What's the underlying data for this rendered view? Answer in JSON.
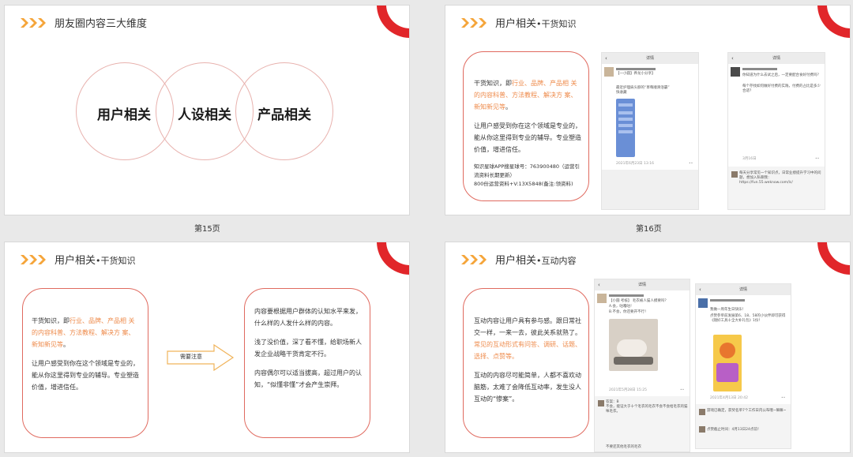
{
  "colors": {
    "accent_orange": "#f5a53a",
    "brand_red": "#e1262a",
    "border_red": "#e06a5f",
    "highlight_orange": "#ee8a4a",
    "circle_pink": "#e8b2ae"
  },
  "pages": {
    "p15": "第15页",
    "p16": "第16页"
  },
  "slide1": {
    "title": "朋友圈内容三大维度",
    "circles": [
      "用户相关",
      "人设相关",
      "产品相关"
    ]
  },
  "slide2": {
    "title_main": "用户相关",
    "title_sub": "•干货知识",
    "text": {
      "p1_a": "干货知识，即",
      "p1_hl": "行业、品牌、产品相 关的内容科普、方法教程、解决方 案、新知新见等",
      "p1_b": "。",
      "p2": "让用户感受到你在这个领域是专业的，能从你这里得到专业的辅导。专业塑造价值，增进信任。",
      "p3": "知识星球APP搜星球号：763900480（运营引流资料长期更新）",
      "p4": "800份运营资料+V:13X5848(备注:领资料)"
    },
    "phone_left": {
      "header": "详情",
      "line1": "【一小圆】养龙小分享】",
      "line2": "最近护理肩头脖的“草莓顺滑浴霸”",
      "line3": "快收藏",
      "time": "2021年6月23日 13:16"
    },
    "phone_right": {
      "header": "详情",
      "line1": "你知道为什么去试之后，一定要配合食好付费吗？",
      "line2": "每个存找如何做好付费的实践，付费的占比是多少合适？",
      "time": "3月16日",
      "comment": "每天分享常见一个知识点，日常业绩提升学习中的问题，想加入私聊我：https://fun.55.weknow.com/lc/"
    }
  },
  "slide3": {
    "title_main": "用户相关",
    "title_sub": "•干货知识",
    "left": {
      "p1_a": "干货知识，即",
      "p1_hl": "行业、品牌、产品相 关的内容科普、方法教程、解决方 案、新知新见等",
      "p1_b": "。",
      "p2": "让用户感受到你在这个领域是专业的，能从你这里得到专业的辅导。专业塑造价值，增进信任。"
    },
    "arrow_label": "需要注意",
    "right": {
      "p1": "内容要根据用户群体的认知水平来发，什么样的人发什么样的内容。",
      "p2": "浅了没价值，深了看不懂，给职场新人发企业战略干货肯定不行。",
      "p3": "内容偶尔可以适当拔高，超过用户的认知，“似懂非懂”才会产生崇拜。"
    }
  },
  "slide4": {
    "title_main": "用户相关",
    "title_sub": "•互动内容",
    "text": {
      "p1_a": "互动内容让用户具有参与感。跟日常社交一样，一来一去，彼此关系就熟了。",
      "p1_hl": "常见的互动形式有问答、调研、话题、选择、点赞等。",
      "p2": "互动的内容尽可能简单，人都不喜欢动脑筋，太难了会降低互动率，发生没人互动的“惨案”。"
    },
    "phone_left": {
      "header": "详情",
      "line1": "【小圆 考核】 毛衣被人猫人摸要吗？",
      "line2": "A.会，咕噜咕！",
      "line3": "B.不会，你还要开不行！",
      "time": "2021年5月28日 15:25",
      "comment1": "答案：B",
      "comment2": "不会，能证大于十个毛衣的毛衣不会不会给毛衣的猫咪毛衣。",
      "comment3": "不要还其他毛衣的毛衣"
    },
    "phone_right": {
      "header": "详情",
      "line1": "我做一周年生日快乐！",
      "line2": "点赞参单前发展第6、18、58的小伙伴即可获得《随好工具十全大补礼包》1份！",
      "time": "2021年4月13日 20:42",
      "comment1": "游戏已确定，获奖名单7个工作日内公布哦~嘛嘛~",
      "comment2": "点赞截止时间：4月13日24点前！"
    }
  }
}
